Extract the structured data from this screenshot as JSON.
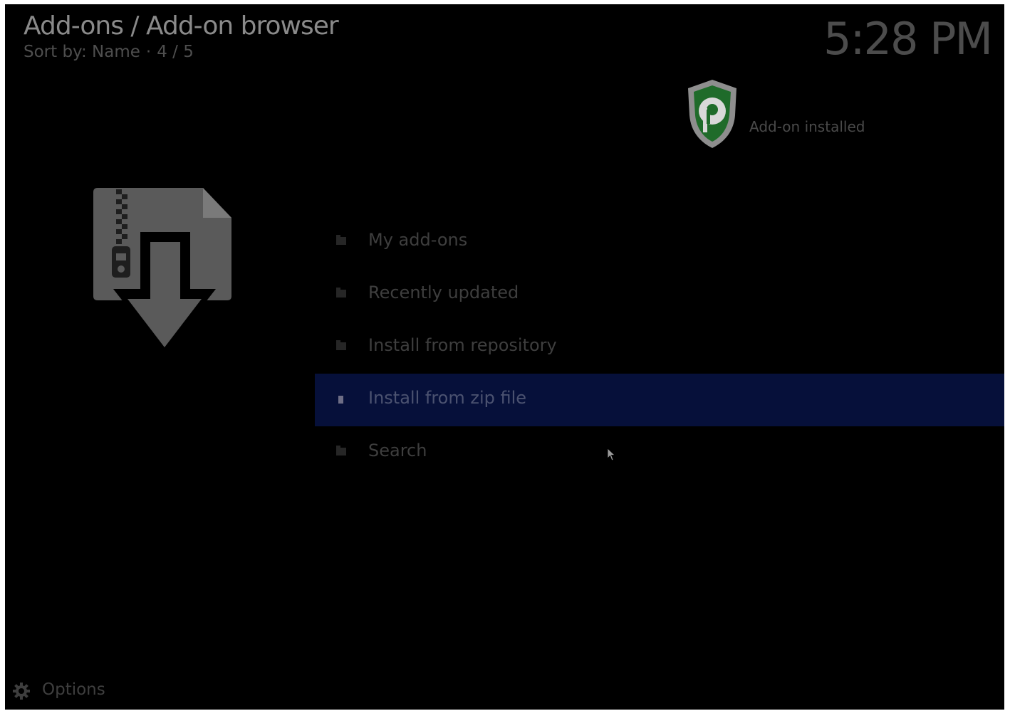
{
  "header": {
    "title": "Add-ons / Add-on browser",
    "sort_label": "Sort by: Name",
    "separator": "·",
    "position": "4 / 5",
    "clock": "5:28 PM"
  },
  "notification": {
    "icon": "purevpn-shield-icon",
    "text": "Add-on installed"
  },
  "art": {
    "icon": "zip-install-icon"
  },
  "menu": {
    "items": [
      {
        "label": "My add-ons",
        "icon": "folder-icon"
      },
      {
        "label": "Recently updated",
        "icon": "folder-icon"
      },
      {
        "label": "Install from repository",
        "icon": "folder-icon"
      },
      {
        "label": "Install from zip file",
        "icon": "folder-icon",
        "selected": true
      },
      {
        "label": "Search",
        "icon": "folder-icon"
      }
    ]
  },
  "footer": {
    "options_label": "Options",
    "icon": "gear-icon"
  },
  "colors": {
    "background": "#000000",
    "selection": "#06103a",
    "shield_green": "#1f6b2a"
  }
}
